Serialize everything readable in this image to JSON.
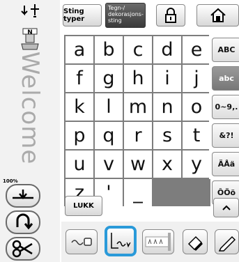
{
  "toolbar": {
    "tab_stitch_types": "Sting typer",
    "tab_char_decorative": "Tegn-/ dekorasjons- sting"
  },
  "sidebar": {
    "vertical_text": "Welcome",
    "zoom_label": "100%"
  },
  "keyboard": {
    "keys": [
      "a",
      "b",
      "c",
      "d",
      "e",
      "f",
      "g",
      "h",
      "i",
      "j",
      "k",
      "l",
      "m",
      "n",
      "o",
      "p",
      "q",
      "r",
      "s",
      "t",
      "u",
      "v",
      "w",
      "x",
      "y",
      "z",
      "'",
      "_",
      "",
      ""
    ]
  },
  "categories": [
    "ABC",
    "abc",
    "0~9,.",
    "&?!",
    "ÄÅä",
    "ÔÖö"
  ],
  "close_button_label": "LUKK",
  "icons": {
    "threading": "needle-threader-icon",
    "presser_foot": "presser-foot-icon",
    "lock": "lock-icon",
    "home": "home-icon",
    "needle_position": "needle-position-icon",
    "reverse": "reverse-stitch-icon",
    "scissors": "scissors-icon"
  }
}
